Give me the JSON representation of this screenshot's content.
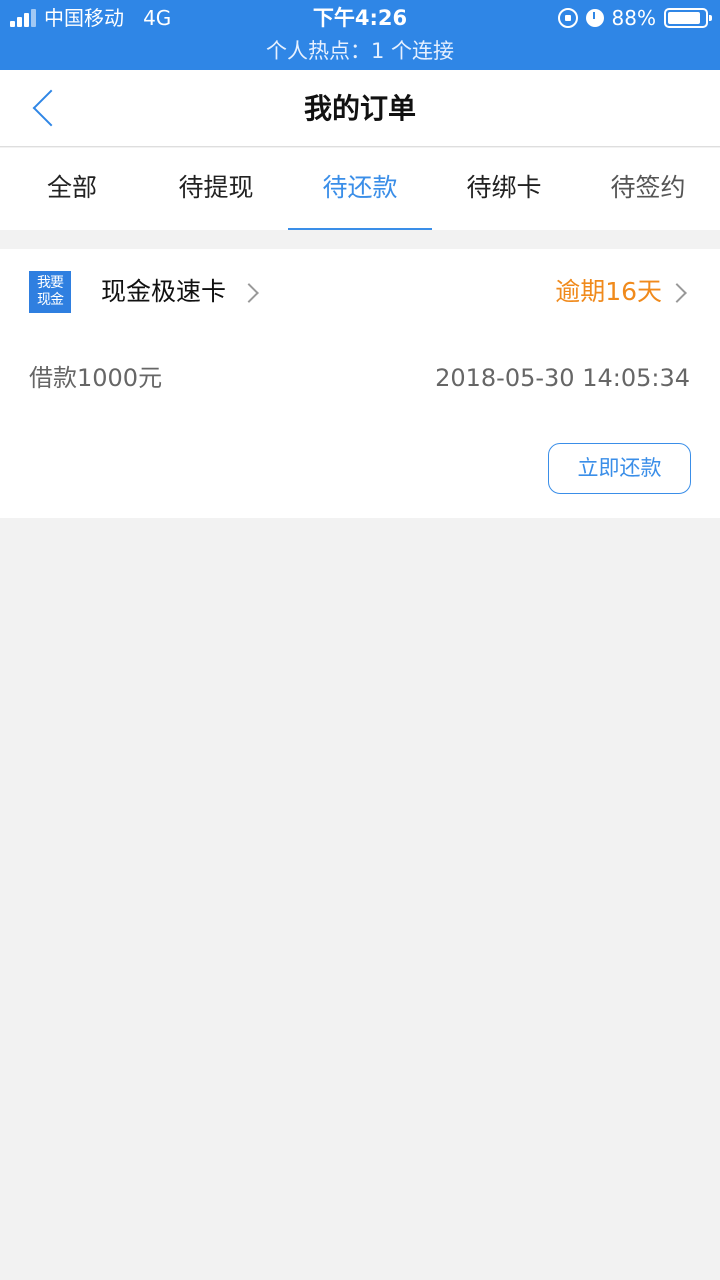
{
  "status_bar": {
    "carrier": "中国移动",
    "network": "4G",
    "time": "下午4:26",
    "battery_percent": "88%",
    "battery_level": 0.88,
    "hotspot": "个人热点：1 个连接"
  },
  "nav": {
    "title": "我的订单"
  },
  "tabs": [
    {
      "label": "全部"
    },
    {
      "label": "待提现"
    },
    {
      "label": "待还款",
      "active": true
    },
    {
      "label": "待绑卡"
    },
    {
      "label": "待签约"
    }
  ],
  "order": {
    "logo_text_line1": "我要",
    "logo_text_line2": "现金",
    "product_name": "现金极速卡",
    "status": "逾期16天",
    "loan_amount": "借款1000元",
    "loan_time": "2018-05-30 14:05:34",
    "repay_label": "立即还款"
  },
  "colors": {
    "accent": "#3a8ee8",
    "status_bar": "#2f86e6",
    "overdue": "#f08a1c"
  }
}
